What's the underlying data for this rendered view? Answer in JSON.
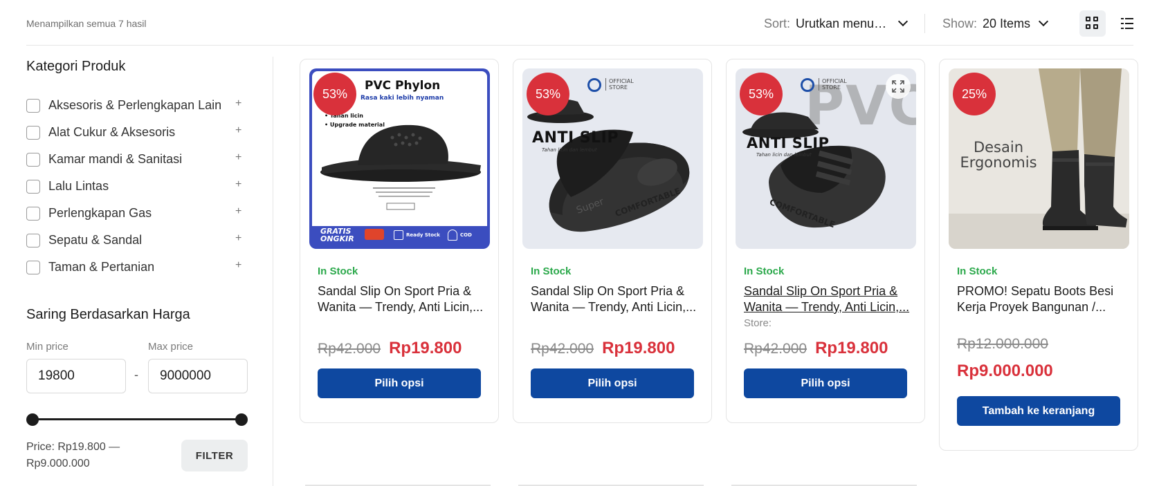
{
  "toolbar": {
    "result_count": "Menampilkan semua 7 hasil",
    "sort_label": "Sort:",
    "sort_value": "Urutkan menurut popularitas",
    "show_label": "Show:",
    "show_value": "20 Items",
    "grid_icon": "grid-view-icon",
    "list_icon": "list-view-icon"
  },
  "sidebar": {
    "categories_title": "Kategori Produk",
    "categories": [
      {
        "label": "Aksesoris & Perlengkapan Lain"
      },
      {
        "label": "Alat Cukur & Aksesoris"
      },
      {
        "label": "Kamar mandi & Sanitasi"
      },
      {
        "label": "Lalu Lintas"
      },
      {
        "label": "Perlengkapan Gas"
      },
      {
        "label": "Sepatu & Sandal"
      },
      {
        "label": "Taman & Pertanian"
      }
    ],
    "expand_symbol": "+",
    "price_title": "Saring Berdasarkan Harga",
    "min_label": "Min price",
    "max_label": "Max price",
    "min_value": "19800",
    "max_value": "9000000",
    "dash": "-",
    "price_range_text": "Price: Rp19.800 — Rp9.000.000",
    "filter_label": "FILTER"
  },
  "products": [
    {
      "badge": "53%",
      "stock": "In Stock",
      "name_line1": "Sandal Slip On Sport Pria &",
      "name_line2": "Wanita — Trendy, Anti Licin,...",
      "old_price": "Rp42.000",
      "new_price": "Rp19.800",
      "button": "Pilih opsi",
      "image": {
        "title": "PVC Phylon",
        "subtitle": "Rasa kaki lebih nyaman",
        "bullet1": "• Tahan licin",
        "bullet2": "• Upgrade material",
        "promo": "GRATIS ONGKIR",
        "ready": "Ready Stock",
        "cod": "COD"
      }
    },
    {
      "badge": "53%",
      "stock": "In Stock",
      "name_line1": "Sandal Slip On Sport Pria &",
      "name_line2": "Wanita — Trendy, Anti Licin,...",
      "old_price": "Rp42.000",
      "new_price": "Rp19.800",
      "button": "Pilih opsi",
      "image": {
        "official": "OFFICIAL STORE",
        "headline": "ANTI SLIP",
        "tagline": "Tahan licin dan lembut",
        "comfort": "COMFORTABLE"
      }
    },
    {
      "badge": "53%",
      "stock": "In Stock",
      "name_line1": "Sandal Slip On Sport Pria &",
      "name_line2": "Wanita — Trendy, Anti Licin,...",
      "store": "Store:",
      "old_price": "Rp42.000",
      "new_price": "Rp19.800",
      "button": "Pilih opsi",
      "image": {
        "official": "OFFICIAL STORE",
        "headline": "ANTI SLIP",
        "tagline": "Tahan licin dan lembut",
        "comfort": "COMFORTABLE",
        "watermark": "PVC"
      }
    },
    {
      "badge": "25%",
      "stock": "In Stock",
      "name_line1": "PROMO! Sepatu Boots Besi",
      "name_line2": "Kerja Proyek Bangunan /...",
      "old_price": "Rp12.000.000",
      "new_price": "Rp9.000.000",
      "button": "Tambah ke keranjang",
      "image": {
        "headline1": "Desain",
        "headline2": "Ergonomis"
      }
    }
  ],
  "colors": {
    "accent_blue": "#0e48a0",
    "sale_red": "#d9313b",
    "stock_green": "#2aa84a"
  }
}
